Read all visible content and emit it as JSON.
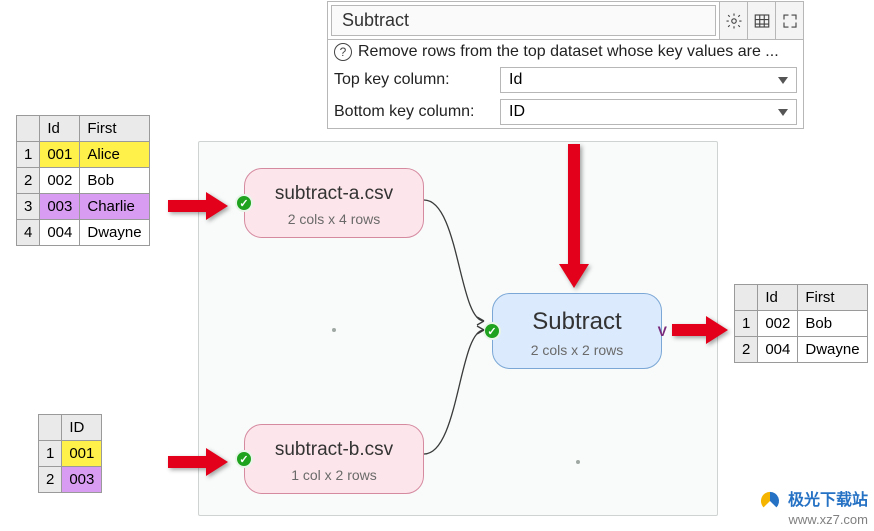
{
  "panel": {
    "title": "Subtract",
    "description": "Remove rows from the top dataset whose key values are ...",
    "top_label": "Top key column:",
    "top_value": "Id",
    "bottom_label": "Bottom key column:",
    "bottom_value": "ID"
  },
  "input_table": {
    "headers": [
      "",
      "Id",
      "First"
    ],
    "rows": [
      {
        "n": "1",
        "id": "001",
        "first": "Alice",
        "hl": "yellow"
      },
      {
        "n": "2",
        "id": "002",
        "first": "Bob",
        "hl": ""
      },
      {
        "n": "3",
        "id": "003",
        "first": "Charlie",
        "hl": "purple"
      },
      {
        "n": "4",
        "id": "004",
        "first": "Dwayne",
        "hl": ""
      }
    ]
  },
  "filter_table": {
    "headers": [
      "",
      "ID"
    ],
    "rows": [
      {
        "n": "1",
        "id": "001",
        "hl": "yellow"
      },
      {
        "n": "2",
        "id": "003",
        "hl": "purple"
      }
    ]
  },
  "output_table": {
    "headers": [
      "",
      "Id",
      "First"
    ],
    "rows": [
      {
        "n": "1",
        "id": "002",
        "first": "Bob"
      },
      {
        "n": "2",
        "id": "004",
        "first": "Dwayne"
      }
    ]
  },
  "nodes": {
    "a": {
      "title": "subtract-a.csv",
      "sub": "2 cols x 4 rows"
    },
    "b": {
      "title": "subtract-b.csv",
      "sub": "1 col x 2 rows"
    },
    "op": {
      "title": "Subtract",
      "sub": "2 cols x 2 rows",
      "badge": "V"
    }
  },
  "watermark": {
    "top": "极光下载站",
    "bottom": "www.xz7.com"
  }
}
